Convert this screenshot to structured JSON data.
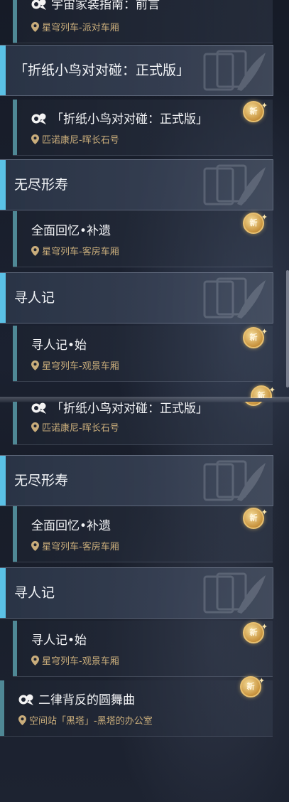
{
  "top": {
    "partial_quest": {
      "name": "宇宙家装指南：前言",
      "location": "星穹列车-派对车厢"
    },
    "headers": [
      "「折纸小鸟对对碰：正式版」",
      "无尽形寿",
      "寻人记"
    ],
    "quests": [
      {
        "name": "「折纸小鸟对对碰：正式版」",
        "location": "匹诺康尼-晖长石号",
        "badge": "新"
      },
      {
        "name": "全面回忆•补遗",
        "location": "星穹列车-客房车厢",
        "badge": "新"
      },
      {
        "name": "寻人记•始",
        "location": "星穹列车-观景车厢",
        "badge": "新"
      }
    ],
    "peek_badge": "新"
  },
  "bottom": {
    "partial_quest": {
      "name": "「折纸小鸟对对碰：正式版」",
      "location": "匹诺康尼-晖长石号"
    },
    "headers": [
      "无尽形寿",
      "寻人记"
    ],
    "quests": [
      {
        "name": "全面回忆•补遗",
        "location": "星穹列车-客房车厢",
        "badge": "新"
      },
      {
        "name": "寻人记•始",
        "location": "星穹列车-观景车厢",
        "badge": "新"
      },
      {
        "name": "二律背反的圆舞曲",
        "location": "空间站「黑塔」-黑塔的办公室",
        "badge": "新"
      }
    ]
  },
  "icons": {
    "category": "companion-mission-icon",
    "location": "map-pin-icon",
    "new": "new-badge-icon"
  },
  "colors": {
    "accent_bar": "#5bc1e6",
    "quest_bar": "#4f8895",
    "location_text": "#c9ad7b",
    "badge_gold": "#e8c070"
  }
}
